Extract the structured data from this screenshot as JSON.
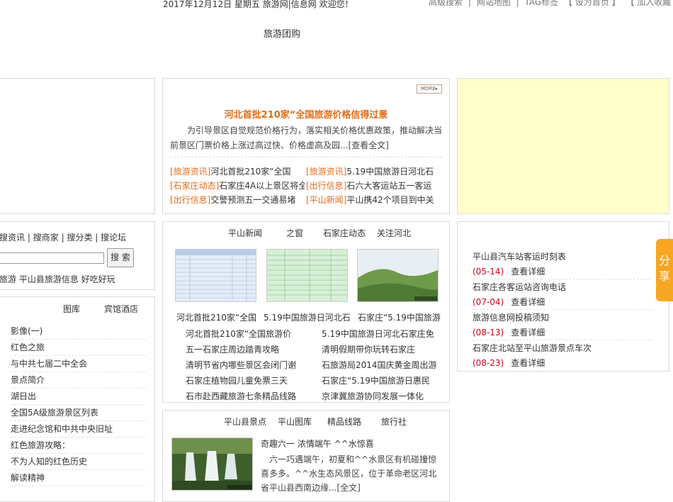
{
  "header": {
    "date_line": "2017年12月12日 星期五 旅游网|信息网 欢迎您！",
    "top_links": [
      "高级搜索",
      "|",
      "网站地图",
      "|",
      "TAG标签",
      "【 设为首页 】",
      "【 加入收藏 】"
    ],
    "nav_item": "旅游团购"
  },
  "headline": {
    "more": "MORE",
    "title": "河北首批210家“全国旅游价格信得过景",
    "summary": "为引导景区自觉规范价格行为，落实相关价格优惠政策，推动解决当前景区门票价格上涨过高过快、价格虚高及园...[查看全文]",
    "items": [
      {
        "tag": "[旅游资讯]",
        "text": "河北首批210家“全国"
      },
      {
        "tag": "[旅游资讯]",
        "text": "5.19中国旅游日河北石"
      },
      {
        "tag": "[石家庄动态]",
        "text": "石家庄4A以上景区将全"
      },
      {
        "tag": "[出行信息]",
        "text": "石六大客运站五一客运"
      },
      {
        "tag": "[出行信息]",
        "text": "交警预测五一交通易堵"
      },
      {
        "tag": "[平山新闻]",
        "text": "平山携42个项目到中关"
      }
    ]
  },
  "search": {
    "tabs": [
      "搜资讯",
      "|",
      "搜商家",
      "|",
      "搜分类",
      "|",
      "搜论坛"
    ],
    "button": "搜 索",
    "hot_words": "旅游 平山县旅游信息 好吃好玩"
  },
  "left_list": {
    "tabs": [
      "图库",
      "宾馆酒店"
    ],
    "items": [
      "影像(一)",
      "红色之旅",
      "与中共七届二中全会",
      "景点简介",
      "湖日出",
      "全国5A级旅游景区列表",
      "走进纪念馆和中共中央旧址",
      "红色旅游攻略：",
      "不为人知的红色历史",
      "解读精神"
    ]
  },
  "news": {
    "tabs": [
      "平山新闻",
      "之窗",
      "石家庄动态",
      "关注河北"
    ],
    "thumbs": [
      "河北首批210家“全国",
      "5.19中国旅游日河北石",
      "石家庄“5.19中国旅游"
    ],
    "items": [
      "河北首批210家“全国旅游价",
      "5.19中国旅游日河北石家庄免",
      "五一石家庄周边踏青攻略",
      "清明假期带你玩转石家庄",
      "清明节省内哪些景区会闭门谢",
      "石旅游局2014国庆黄金周出游",
      "石家庄植物园儿童免票三天",
      "石家庄“5.19中国旅游日惠民",
      "石市赴西藏旅游七条精品线路",
      "京津冀旅游协同发展一体化"
    ]
  },
  "scenic": {
    "tabs": [
      "平山县景点",
      "平山图库",
      "精品线路",
      "旅行社"
    ],
    "title": "奇趣六一 浓情端午 ^^水惊喜",
    "summary": "六一巧遇端午，初夏和^^水景区有机碰撞惊喜多多。^^水生态风景区，位于革命老区河北省平山县西南边缘...[全文]"
  },
  "transport": {
    "items": [
      {
        "title": "平山县汽车站客运时刻表",
        "date": "(05-14)",
        "link": "查看详细"
      },
      {
        "title": "石家庄各客运站咨询电话",
        "date": "(07-04)",
        "link": "查看详细"
      },
      {
        "title": "旅游信息网投稿须知",
        "date": "(08-13)",
        "link": "查看详细"
      },
      {
        "title": "石家庄北站至平山旅游景点车次",
        "date": "(08-23)",
        "link": "查看详细"
      }
    ]
  },
  "share": "分享",
  "colors": {
    "accent": "#e06c18",
    "date_red": "#d0021b",
    "ad_bg": "#ffffcc",
    "share_bg": "#f6a623"
  }
}
